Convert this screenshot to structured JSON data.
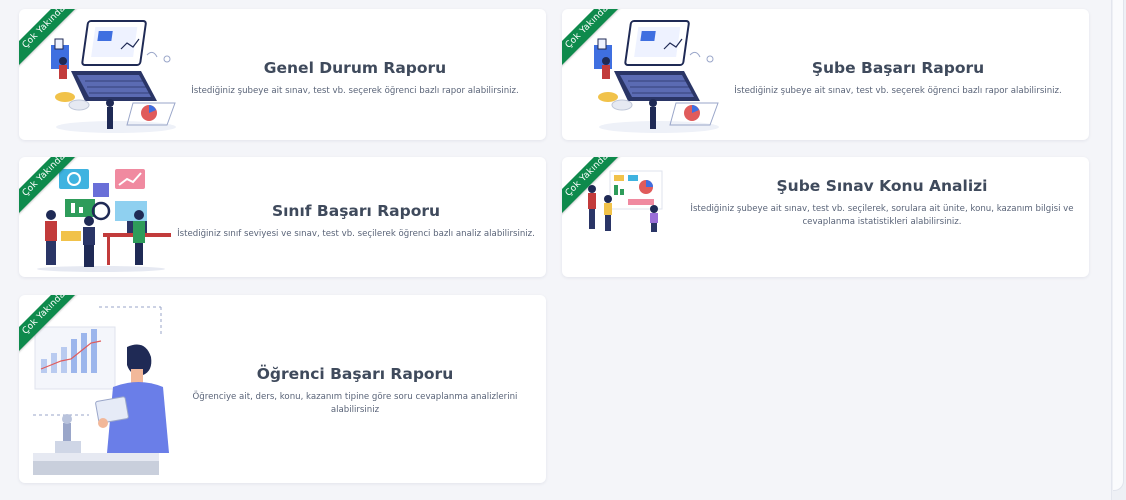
{
  "ribbon_label": "Çok Yakında",
  "colors": {
    "ribbon": "#0e8a4c",
    "title": "#3f4a5c",
    "desc": "#5a6478",
    "background": "#f4f5f9"
  },
  "cards": [
    {
      "title": "Genel Durum Raporu",
      "description": "İstediğiniz şubeye ait sınav, test vb. seçerek öğrenci bazlı rapor alabilirsiniz."
    },
    {
      "title": "Şube Başarı Raporu",
      "description": "İstediğiniz şubeye ait sınav, test vb. seçerek öğrenci bazlı rapor alabilirsiniz."
    },
    {
      "title": "Sınıf Başarı Raporu",
      "description": "İstediğiniz sınıf seviyesi ve sınav, test vb. seçilerek öğrenci bazlı analiz alabilirsiniz."
    },
    {
      "title": "Şube Sınav Konu Analizi",
      "description": "İstediğiniz şubeye ait sınav, test vb. seçilerek, sorulara ait ünite, konu, kazanım bilgisi ve cevaplanma istatistikleri alabilirsiniz."
    },
    {
      "title": "Öğrenci Başarı Raporu",
      "description": "Öğrenciye ait, ders, konu, kazanım tipine göre soru cevaplanma analizlerini alabilirsiniz"
    }
  ]
}
